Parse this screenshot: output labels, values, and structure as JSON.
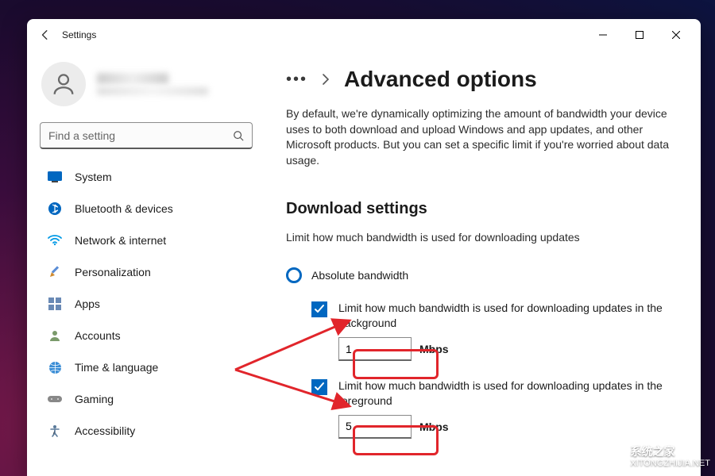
{
  "app_title": "Settings",
  "search": {
    "placeholder": "Find a setting"
  },
  "nav": [
    {
      "key": "system",
      "label": "System"
    },
    {
      "key": "bluetooth",
      "label": "Bluetooth & devices"
    },
    {
      "key": "network",
      "label": "Network & internet"
    },
    {
      "key": "personalization",
      "label": "Personalization"
    },
    {
      "key": "apps",
      "label": "Apps"
    },
    {
      "key": "accounts",
      "label": "Accounts"
    },
    {
      "key": "time",
      "label": "Time & language"
    },
    {
      "key": "gaming",
      "label": "Gaming"
    },
    {
      "key": "accessibility",
      "label": "Accessibility"
    }
  ],
  "breadcrumb": {
    "title": "Advanced options"
  },
  "intro": "By default, we're dynamically optimizing the amount of bandwidth your device uses to both download and upload Windows and app updates, and other Microsoft products. But you can set a specific limit if you're worried about data usage.",
  "download": {
    "heading": "Download settings",
    "sub": "Limit how much bandwidth is used for downloading updates",
    "radio_label": "Absolute bandwidth",
    "bg_check_label": "Limit how much bandwidth is used for downloading updates in the background",
    "bg_value": "1",
    "fg_check_label": "Limit how much bandwidth is used for downloading updates in the foreground",
    "fg_value": "5",
    "unit": "Mbps"
  },
  "watermark": {
    "cn": "系统之家",
    "url": "XITONGZHIJIA.NET"
  },
  "colors": {
    "accent": "#0067c0",
    "annotation": "#e1252b"
  }
}
